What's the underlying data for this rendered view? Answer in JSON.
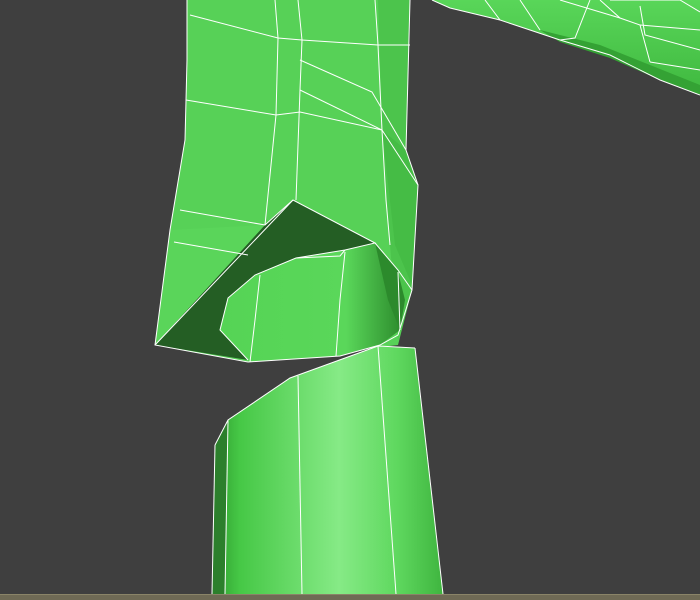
{
  "app": {
    "window": "3d-viewport",
    "view_mode": "shaded-with-wireframe-edges"
  },
  "scene": {
    "object": "green-poly-mesh",
    "mesh_color": "#4fd44f",
    "mesh_light": "#7ee87e",
    "mesh_dark": "#2f8f2f",
    "cavity_color": "#215a21",
    "edge_color": "#ffffff",
    "background_color": "#3f3f3f"
  },
  "status_strip": {
    "color": "#6f6a55"
  }
}
